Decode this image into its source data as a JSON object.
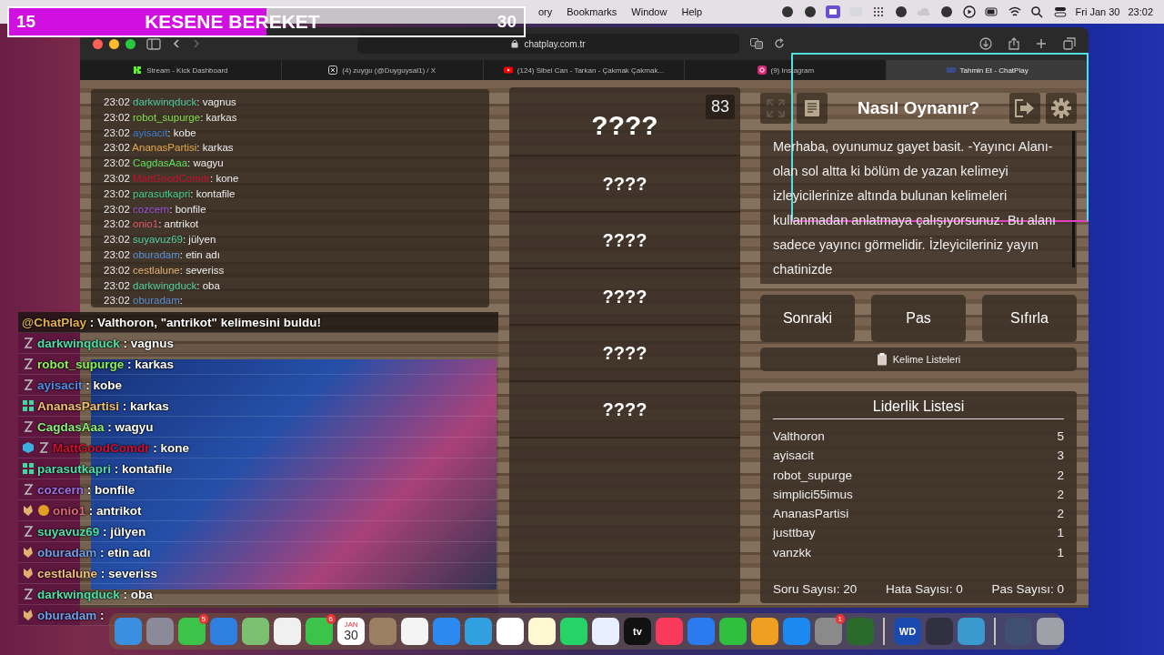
{
  "stream_bar": {
    "start": "15",
    "title": "KESENE BEREKET",
    "end": "30",
    "level": 0.5
  },
  "menu_bar": {
    "items": [
      "ory",
      "Bookmarks",
      "Window",
      "Help"
    ],
    "date": "Fri Jan 30",
    "time": "23:02"
  },
  "browser": {
    "address": "chatplay.com.tr",
    "tabs": [
      {
        "label": "Stream - Kick Dashboard",
        "kind": "kick",
        "selected": false
      },
      {
        "label": "(4) zuygu (@Duyguysal1) / X",
        "kind": "x",
        "selected": false
      },
      {
        "label": "(124) Sibel Can - Tarkan - Çakmak Çakmak...",
        "kind": "youtube",
        "selected": false
      },
      {
        "label": "(9) Instagram",
        "kind": "instagram",
        "selected": false
      },
      {
        "label": "Tahmin Et - ChatPlay",
        "kind": "cp",
        "selected": true
      }
    ]
  },
  "page_chat": [
    {
      "time": "23:02",
      "name": "darkwinqduck",
      "color": "#4fc9a0",
      "message": ": vagnus"
    },
    {
      "time": "23:02",
      "name": "robot_supurge",
      "color": "#7ee04a",
      "message": ": karkas"
    },
    {
      "time": "23:02",
      "name": "ayisacit",
      "color": "#3b7fd6",
      "message": ": kobe"
    },
    {
      "time": "23:02",
      "name": "AnanasPartisi",
      "color": "#e0a84a",
      "message": ": karkas"
    },
    {
      "time": "23:02",
      "name": "CagdasAaa",
      "color": "#5ee05a",
      "message": ": wagyu"
    },
    {
      "time": "23:02",
      "name": "MattGoodComdr",
      "color": "#c8102e",
      "message": ": kone"
    },
    {
      "time": "23:02",
      "name": "parasutkapri",
      "color": "#3fd08a",
      "message": ": kontafile"
    },
    {
      "time": "23:02",
      "name": "cozcern",
      "color": "#9b4fe0",
      "message": ": bonfile"
    },
    {
      "time": "23:02",
      "name": "onio1",
      "color": "#e05a6a",
      "message": ": antrikot"
    },
    {
      "time": "23:02",
      "name": "suyavuz69",
      "color": "#4fd0a0",
      "message": ": jülyen"
    },
    {
      "time": "23:02",
      "name": "oburadam",
      "color": "#5a8fd6",
      "message": ": etin adı"
    },
    {
      "time": "23:02",
      "name": "cestlalune",
      "color": "#e0b070",
      "message": ": severiss"
    },
    {
      "time": "23:02",
      "name": "darkwingduck",
      "color": "#4fd0a0",
      "message": ": oba"
    },
    {
      "time": "23:02",
      "name": "oburadam",
      "color": "#5a8fd6",
      "message": ":"
    }
  ],
  "game": {
    "counter": "83",
    "words": [
      "????",
      "????",
      "????",
      "????",
      "????",
      "????"
    ]
  },
  "how_to": {
    "title": "Nasıl Oynanır?",
    "text": "Merhaba, oyunumuz gayet basit. -Yayıncı Alanı- olan sol altta ki bölüm de yazan kelimeyi izleyicilerinize altında bulunan kelimeleri kullanmadan anlatmaya çalışıyorsunuz. Bu alanı sadece yayıncı görmelidir. İzleyicileriniz yayın chatinizde"
  },
  "buttons": [
    "Sonraki",
    "Pas",
    "Sıfırla"
  ],
  "word_lists_button": "Kelime Listeleri",
  "leaderboard": {
    "title": "Liderlik Listesi",
    "rows": [
      {
        "name": "Valthoron",
        "score": "5"
      },
      {
        "name": "ayisacit",
        "score": "3"
      },
      {
        "name": "robot_supurge",
        "score": "2"
      },
      {
        "name": "simplici55imus",
        "score": "2"
      },
      {
        "name": "AnanasPartisi",
        "score": "2"
      },
      {
        "name": "justtbay",
        "score": "1"
      },
      {
        "name": "vanzkk",
        "score": "1"
      }
    ],
    "stats": [
      "Soru Sayısı: 20",
      "Hata Sayısı: 0",
      "Pas Sayısı: 0"
    ]
  },
  "stream_chat": [
    {
      "name": "@ChatPlay",
      "color": "#e0b050",
      "message": ": Valthoron, \"antrikot\" kelimesini buldu!",
      "kind": "system"
    },
    {
      "badges": [
        {
          "kind": "z"
        }
      ],
      "name": "darkwinqduck",
      "color": "#4fe0a8",
      "message": ": vagnus",
      "kind": "user"
    },
    {
      "badges": [
        {
          "kind": "z"
        }
      ],
      "name": "robot_supurge",
      "color": "#8ef05a",
      "message": ": karkas",
      "kind": "user"
    },
    {
      "badges": [
        {
          "kind": "z"
        }
      ],
      "name": "ayisacit",
      "color": "#4f8fe6",
      "message": ": kobe",
      "kind": "user"
    },
    {
      "badges": [
        {
          "kind": "og"
        }
      ],
      "name": "AnanasPartisi",
      "color": "#f0c070",
      "message": ": karkas",
      "kind": "user"
    },
    {
      "badges": [
        {
          "kind": "z"
        }
      ],
      "name": "CagdasAaa",
      "color": "#8ef07a",
      "message": ": wagyu",
      "kind": "user"
    },
    {
      "badges": [
        {
          "kind": "gift"
        },
        {
          "kind": "z"
        }
      ],
      "name": "MattGoodComdr",
      "color": "#d0102e",
      "message": ": kone",
      "kind": "user"
    },
    {
      "badges": [
        {
          "kind": "og"
        }
      ],
      "name": "parasutkapri",
      "color": "#4fe0a8",
      "message": ": kontafile",
      "kind": "user"
    },
    {
      "badges": [
        {
          "kind": "z"
        }
      ],
      "name": "cozcern",
      "color": "#a06fe6",
      "message": ": bonfile",
      "kind": "user"
    },
    {
      "badges": [
        {
          "kind": "fox"
        },
        {
          "kind": "coin"
        }
      ],
      "name": "onio1",
      "color": "#e06a7a",
      "message": ": antrikot",
      "kind": "user"
    },
    {
      "badges": [
        {
          "kind": "z"
        }
      ],
      "name": "suyavuz69",
      "color": "#4fe0a8",
      "message": ": jülyen",
      "kind": "user"
    },
    {
      "badges": [
        {
          "kind": "fox"
        }
      ],
      "name": "oburadam",
      "color": "#6f9fe6",
      "message": ": etin adı",
      "kind": "user"
    },
    {
      "badges": [
        {
          "kind": "fox"
        }
      ],
      "name": "cestlalune",
      "color": "#f0c080",
      "message": ": severiss",
      "kind": "user"
    },
    {
      "badges": [
        {
          "kind": "z"
        }
      ],
      "name": "darkwinqduck",
      "color": "#4fe0a8",
      "message": ": oba",
      "kind": "user"
    },
    {
      "badges": [
        {
          "kind": "fox"
        }
      ],
      "name": "oburadam",
      "color": "#6f9fe6",
      "message": ":",
      "kind": "user"
    }
  ],
  "dock": [
    {
      "color": "#3a8fe0"
    },
    {
      "color": "#8a8a9a"
    },
    {
      "color": "#3cc44a",
      "badge": "5"
    },
    {
      "color": "#2f7fe0"
    },
    {
      "color": "#7ac070"
    },
    {
      "color": "#f0f0f0"
    },
    {
      "color": "#3cc44a",
      "badge": "6"
    },
    {
      "color": "#ffffff",
      "kind": "calendar",
      "month": "JAN",
      "day": "30"
    },
    {
      "color": "#9a8060"
    },
    {
      "color": "#f4f4f4"
    },
    {
      "color": "#2a8af0"
    },
    {
      "color": "#30a0e0"
    },
    {
      "color": "#ffffff"
    },
    {
      "color": "#fff8d0"
    },
    {
      "color": "#25d366"
    },
    {
      "color": "#e8f0ff"
    },
    {
      "color": "#111111",
      "kind": "text",
      "text": "tv"
    },
    {
      "color": "#fa3a5a"
    },
    {
      "color": "#2a7af0"
    },
    {
      "color": "#30c040"
    },
    {
      "color": "#f0a020"
    },
    {
      "color": "#1a8af0"
    },
    {
      "color": "#8a8a8a",
      "badge": "1"
    },
    {
      "color": "#2a6a2a"
    },
    {
      "color": "#1a4ab0",
      "kind": "text",
      "text": "WD",
      "separator": true
    },
    {
      "color": "#303040"
    },
    {
      "color": "#3a9ad0"
    },
    {
      "color": "#405070",
      "separator": true
    },
    {
      "color": "#a0a0a8"
    }
  ]
}
